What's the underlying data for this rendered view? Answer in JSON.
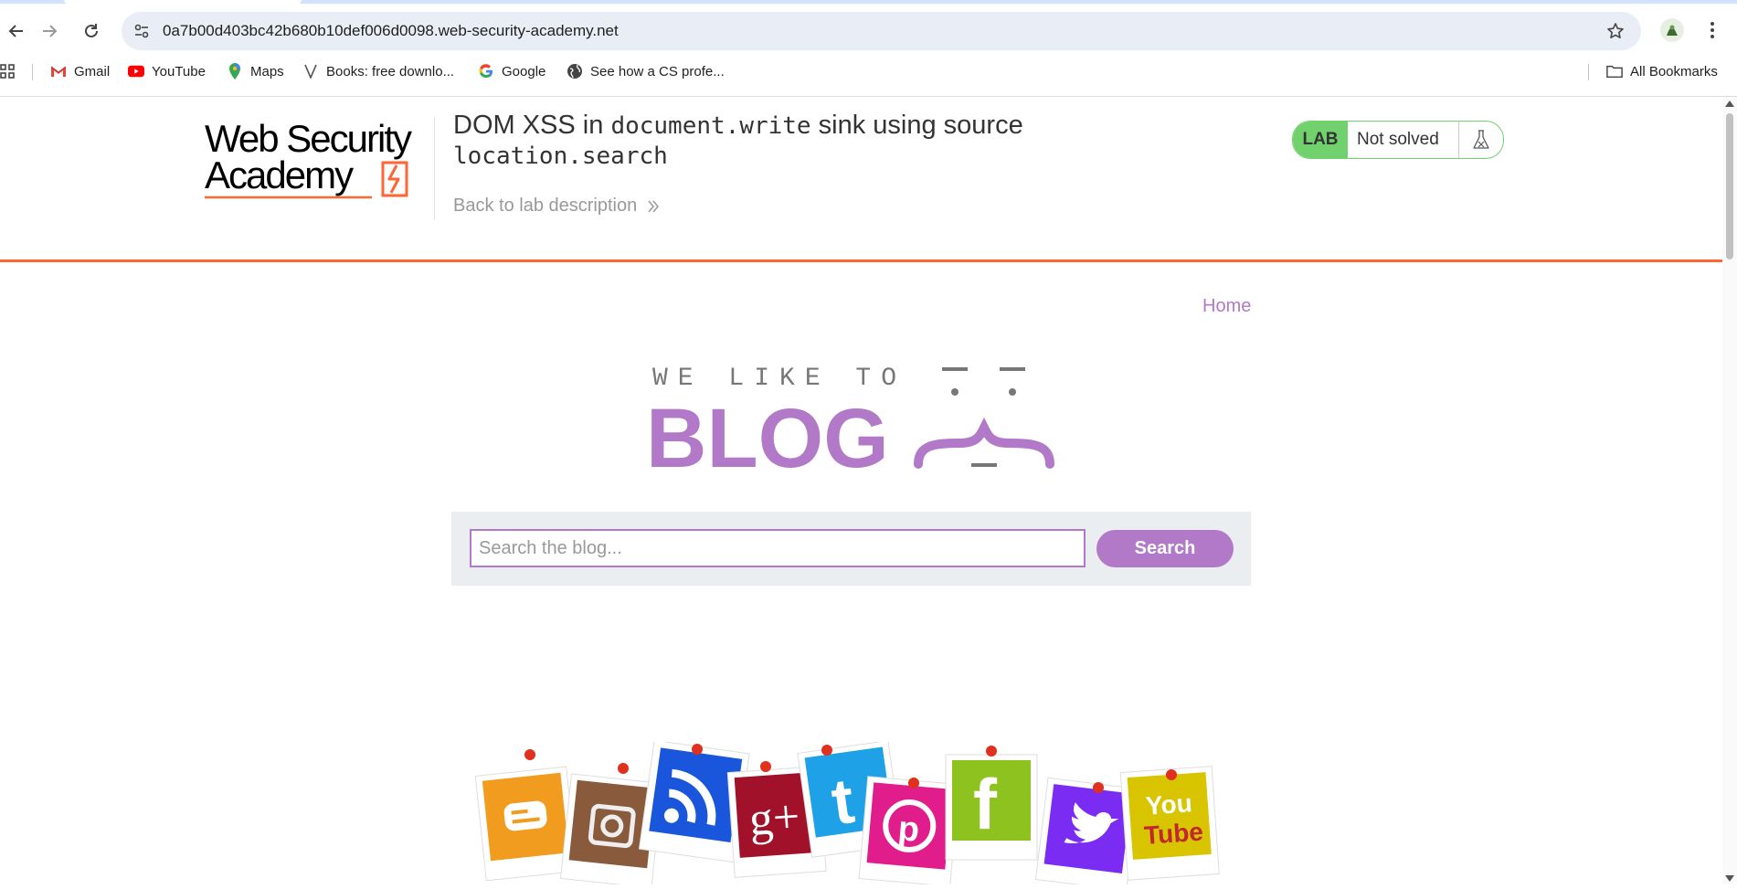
{
  "browser": {
    "url": "0a7b00d403bc42b680b10def006d0098.web-security-academy.net",
    "bookmarks": [
      {
        "label": "Gmail",
        "icon": "gmail-icon"
      },
      {
        "label": "YouTube",
        "icon": "youtube-icon"
      },
      {
        "label": "Maps",
        "icon": "maps-icon"
      },
      {
        "label": "Books: free downlo...",
        "icon": "books-icon"
      },
      {
        "label": "Google",
        "icon": "google-icon"
      },
      {
        "label": "See how a CS profe...",
        "icon": "globe-icon"
      }
    ],
    "all_bookmarks_label": "All Bookmarks"
  },
  "lab_header": {
    "logo_line1": "Web Security",
    "logo_line2": "Academy",
    "title_part1": "DOM XSS in ",
    "title_code1": "document.write",
    "title_part2": " sink using source",
    "title_code2": "location.search",
    "back_link": "Back to lab description",
    "status_tag": "LAB",
    "status_text": "Not solved"
  },
  "nav": {
    "home_label": "Home"
  },
  "blog_logo": {
    "tagline": "WE LIKE TO",
    "word": "BLOG"
  },
  "search": {
    "placeholder": "Search the blog...",
    "value": "",
    "button_label": "Search"
  },
  "social_cards": [
    {
      "label": "Blogger"
    },
    {
      "label": "Instagram"
    },
    {
      "label": "RSS"
    },
    {
      "label": "Google+"
    },
    {
      "label": "Tumblr"
    },
    {
      "label": "Pinterest"
    },
    {
      "label": "Facebook"
    },
    {
      "label": "Twitter"
    },
    {
      "label": "YouTube",
      "text1": "You",
      "text2": "Tube"
    }
  ],
  "colors": {
    "accent": "#b179c7",
    "header_rule": "#ff6633",
    "lab_green": "#70d16d"
  }
}
